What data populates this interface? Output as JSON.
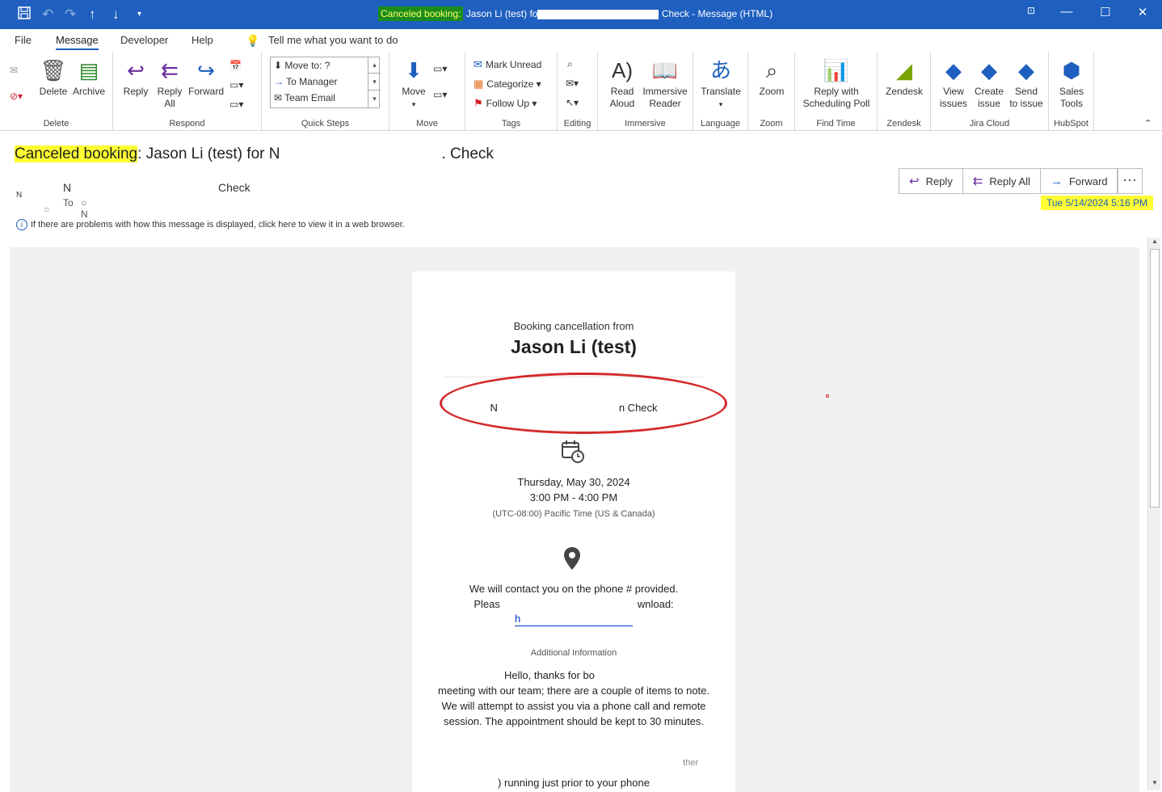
{
  "window": {
    "title_highlight": "Canceled booking:",
    "title_visible_start": "Jason Li (test) fo",
    "title_visible_end": "Check",
    "title_suffix": "- Message (HTML)"
  },
  "tabs": [
    "File",
    "Message",
    "Developer",
    "Help"
  ],
  "active_tab": "Message",
  "tell_me": "Tell me what you want to do",
  "ribbon": {
    "delete_group": {
      "label": "Delete",
      "delete": "Delete",
      "archive": "Archive"
    },
    "respond_group": {
      "label": "Respond",
      "reply": "Reply",
      "reply_all_1": "Reply",
      "reply_all_2": "All",
      "forward": "Forward"
    },
    "quick_steps_group": {
      "label": "Quick Steps",
      "items": [
        "Move to: ?",
        "To Manager",
        "Team Email"
      ]
    },
    "move_group": {
      "label": "Move",
      "move": "Move"
    },
    "tags_group": {
      "label": "Tags",
      "mark_unread": "Mark Unread",
      "categorize": "Categorize",
      "follow_up": "Follow Up"
    },
    "editing_group": {
      "label": "Editing"
    },
    "immersive_group": {
      "label": "Immersive",
      "read_aloud_1": "Read",
      "read_aloud_2": "Aloud",
      "immersive_reader_1": "Immersive",
      "immersive_reader_2": "Reader"
    },
    "language_group": {
      "label": "Language",
      "translate": "Translate"
    },
    "zoom_group": {
      "label": "Zoom",
      "zoom": "Zoom"
    },
    "find_time_group": {
      "label": "Find Time",
      "reply_poll_1": "Reply with",
      "reply_poll_2": "Scheduling Poll"
    },
    "zendesk_group": {
      "label": "Zendesk",
      "zendesk": "Zendesk"
    },
    "jira_group": {
      "label": "Jira Cloud",
      "view_issues_1": "View",
      "view_issues_2": "issues",
      "create_issue_1": "Create",
      "create_issue_2": "issue",
      "send_issue_1": "Send",
      "send_issue_2": "to issue"
    },
    "hubspot_group": {
      "label": "HubSpot",
      "sales_tools_1": "Sales",
      "sales_tools_2": "Tools"
    }
  },
  "message": {
    "subject_highlight": "Canceled booking",
    "subject_colon": ":",
    "subject_start": "Jason Li (test) for",
    "subject_partial": "N",
    "subject_end": ". Check",
    "sender_initials": "N",
    "sender_partial": "N",
    "sender_end": "Check",
    "to_label": "To",
    "to_partial": "N",
    "reply": "Reply",
    "reply_all": "Reply All",
    "forward": "Forward",
    "more": "···",
    "date": "Tue 5/14/2024 5:16 PM",
    "info_bar": "If there are problems with how this message is displayed, click here to view it in a web browser."
  },
  "email": {
    "heading": "Booking cancellation from",
    "name": "Jason Li (test)",
    "service_partial": "N",
    "service_end": "n Check",
    "date": "Thursday, May 30, 2024",
    "time": "3:00 PM - 4:00 PM",
    "timezone": "(UTC-08:00) Pacific Time (US & Canada)",
    "contact_line": "We will contact you on the phone # provided.",
    "please_start": "Pleas",
    "please_end": "wnload:",
    "link_partial": "h",
    "additional_label": "Additional Information",
    "info_start": "Hello, thanks for bo",
    "info_rest": "meeting with our team; there are a couple of items to note.  We will attempt to assist you via a phone call and remote session.  The appointment should be kept to 30 minutes.",
    "info_cut": "ther",
    "info_last": ") running just prior to your phone"
  }
}
